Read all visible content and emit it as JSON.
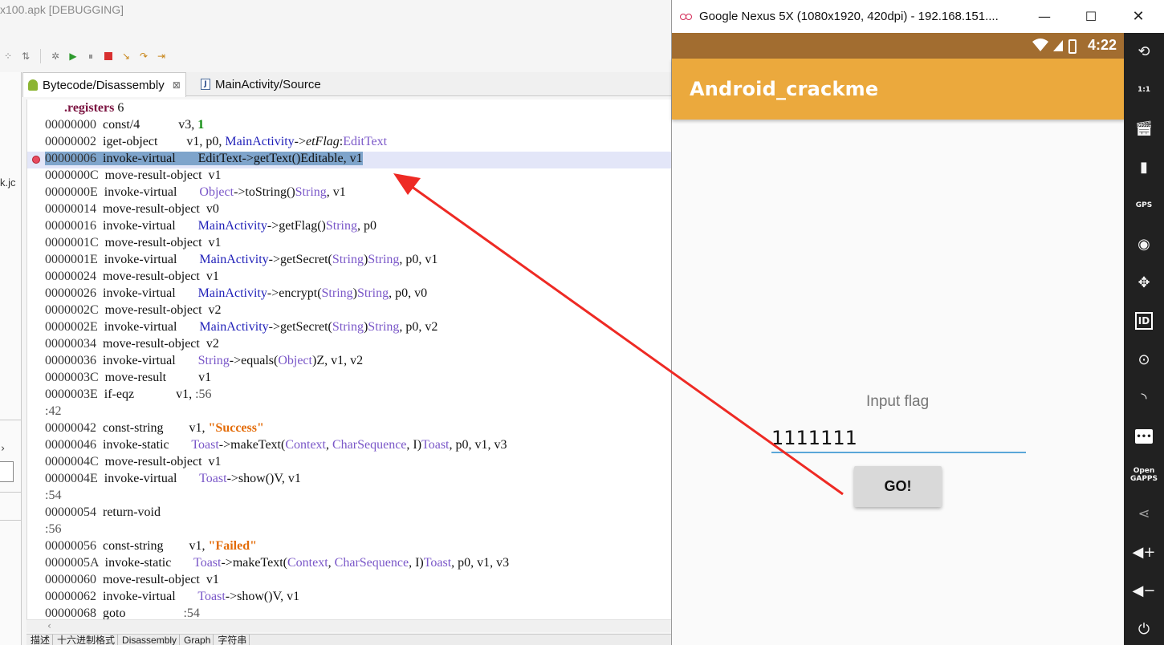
{
  "ide": {
    "title": "x100.apk [DEBUGGING]",
    "tabs": [
      {
        "label": "Bytecode/Disassembly",
        "close": "⊠"
      },
      {
        "label": "MainActivity/Source"
      }
    ],
    "left_fragment": "k.jc",
    "bottom_tabs": [
      "描述",
      "十六进制格式",
      "Disassembly",
      "Graph",
      "字符串"
    ]
  },
  "code": {
    "registers_directive": ".registers",
    "registers_count": "6",
    "lines": [
      {
        "addr": "00000000",
        "op": "const/4",
        "rest": "v3, ",
        "num": "1"
      },
      {
        "addr": "00000002",
        "op": "iget-object",
        "pre": "v1, p0, ",
        "cls": "MainActivity",
        "arrow": "->",
        "field": "etFlag",
        "colon": ":",
        "typ": "EditText"
      },
      {
        "addr": "00000006",
        "op": "invoke-virtual",
        "rest": "EditText->getText()Editable, v1"
      },
      {
        "addr": "0000000C",
        "op": "move-result-object",
        "rest": "v1"
      },
      {
        "addr": "0000000E",
        "op": "invoke-virtual",
        "typ1": "Object",
        "mid": "->toString()",
        "typ2": "String",
        "tail": ", v1"
      },
      {
        "addr": "00000014",
        "op": "move-result-object",
        "rest": "v0"
      },
      {
        "addr": "00000016",
        "op": "invoke-virtual",
        "cls": "MainActivity",
        "mid": "->getFlag()",
        "typ2": "String",
        "tail": ", p0"
      },
      {
        "addr": "0000001C",
        "op": "move-result-object",
        "rest": "v1"
      },
      {
        "addr": "0000001E",
        "op": "invoke-virtual",
        "cls": "MainActivity",
        "mid": "->getSecret(",
        "typ1": "String",
        "mid2": ")",
        "typ2": "String",
        "tail": ", p0, v1"
      },
      {
        "addr": "00000024",
        "op": "move-result-object",
        "rest": "v1"
      },
      {
        "addr": "00000026",
        "op": "invoke-virtual",
        "cls": "MainActivity",
        "mid": "->encrypt(",
        "typ1": "String",
        "mid2": ")",
        "typ2": "String",
        "tail": ", p0, v0"
      },
      {
        "addr": "0000002C",
        "op": "move-result-object",
        "rest": "v2"
      },
      {
        "addr": "0000002E",
        "op": "invoke-virtual",
        "cls": "MainActivity",
        "mid": "->getSecret(",
        "typ1": "String",
        "mid2": ")",
        "typ2": "String",
        "tail": ", p0, v2"
      },
      {
        "addr": "00000034",
        "op": "move-result-object",
        "rest": "v2"
      },
      {
        "addr": "00000036",
        "op": "invoke-virtual",
        "typ0": "String",
        "mid": "->equals(",
        "typ1": "Object",
        "mid2": ")Z, v1, v2"
      },
      {
        "addr": "0000003C",
        "op": "move-result",
        "rest": "v1"
      },
      {
        "addr": "0000003E",
        "op": "if-eqz",
        "rest": "v1, ",
        "lbl": ":56"
      },
      {
        "label": ":42"
      },
      {
        "addr": "00000042",
        "op": "const-string",
        "rest": "v1, ",
        "str": "\"Success\""
      },
      {
        "addr": "00000046",
        "op": "invoke-static",
        "typ0": "Toast",
        "mid": "->makeText(",
        "typ1": "Context",
        "sep": ", ",
        "typ3": "CharSequence",
        "mid2": ", I)",
        "typ2": "Toast",
        "tail": ", p0, v1, v3"
      },
      {
        "addr": "0000004C",
        "op": "move-result-object",
        "rest": "v1"
      },
      {
        "addr": "0000004E",
        "op": "invoke-virtual",
        "typ0": "Toast",
        "mid": "->show()V, v1"
      },
      {
        "label": ":54"
      },
      {
        "addr": "00000054",
        "op": "return-void"
      },
      {
        "label": ":56"
      },
      {
        "addr": "00000056",
        "op": "const-string",
        "rest": "v1, ",
        "str": "\"Failed\""
      },
      {
        "addr": "0000005A",
        "op": "invoke-static",
        "typ0": "Toast",
        "mid": "->makeText(",
        "typ1": "Context",
        "sep": ", ",
        "typ3": "CharSequence",
        "mid2": ", I)",
        "typ2": "Toast",
        "tail": ", p0, v1, v3"
      },
      {
        "addr": "00000060",
        "op": "move-result-object",
        "rest": "v1"
      },
      {
        "addr": "00000062",
        "op": "invoke-virtual",
        "typ0": "Toast",
        "mid": "->show()V, v1"
      },
      {
        "addr": "00000068",
        "op": "goto",
        "lbl": ":54"
      }
    ]
  },
  "emulator": {
    "window_title": "Google Nexus 5X (1080x1920, 420dpi) - 192.168.151....",
    "status_time": "4:22",
    "app_title": "Android_crackme",
    "hint_label": "Input flag",
    "flag_value": "1111111",
    "go_label": "GO!",
    "sidebar": [
      "rotate-icon",
      "one-to-one-icon",
      "clapper-icon",
      "battery-icon",
      "gps-icon",
      "camera-icon",
      "move-icon",
      "id-icon",
      "disk-icon",
      "rss-icon",
      "message-icon",
      "opengapps-icon",
      "share-icon",
      "volume-up-icon",
      "volume-down-icon",
      "power-icon"
    ],
    "sidebar_labels": {
      "gps": "GPS",
      "id": "ID",
      "one_to_one": "1:1",
      "opengapps": "Open\nGAPPS"
    }
  },
  "colors": {
    "status_bar": "#a26d30",
    "app_bar": "#eba93d",
    "breakpoint": "#e84a5f",
    "annotation_arrow": "#ee2a24",
    "class_blue": "#1f1fb8",
    "type_purple": "#7a57c8",
    "string_orange": "#e36c09"
  }
}
